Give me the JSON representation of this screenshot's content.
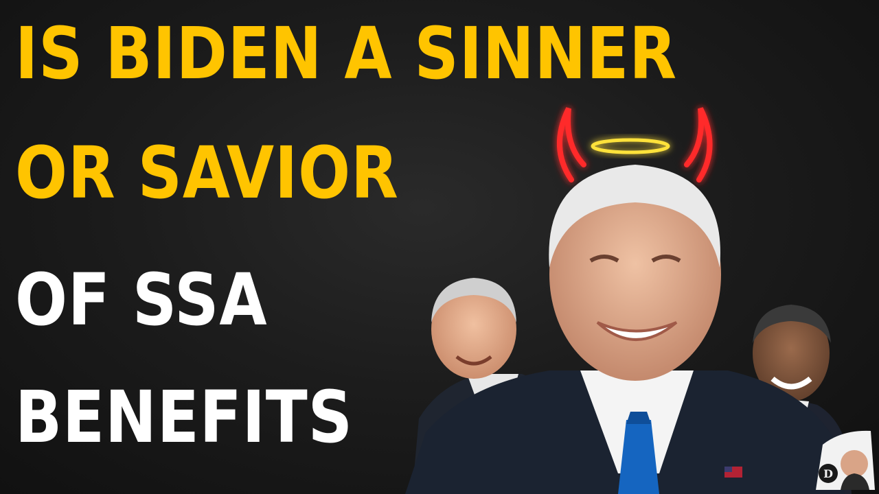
{
  "headline": {
    "line1": "IS BIDEN A SINNER",
    "line2": "OR SAVIOR",
    "line3": "OF SSA",
    "line4": "BENEFITS"
  },
  "colors": {
    "background": "#151515",
    "headline_yellow": "#FFC400",
    "headline_white": "#FFFFFF",
    "horns_red": "#FF2A2A",
    "halo_yellow": "#FFE23A",
    "tie_blue": "#1565C0"
  },
  "icons": {
    "horns": "devil-horns-icon",
    "halo": "halo-icon",
    "flag_pin": "us-flag-pin-icon",
    "channel_logo": "channel-logo-badge"
  }
}
